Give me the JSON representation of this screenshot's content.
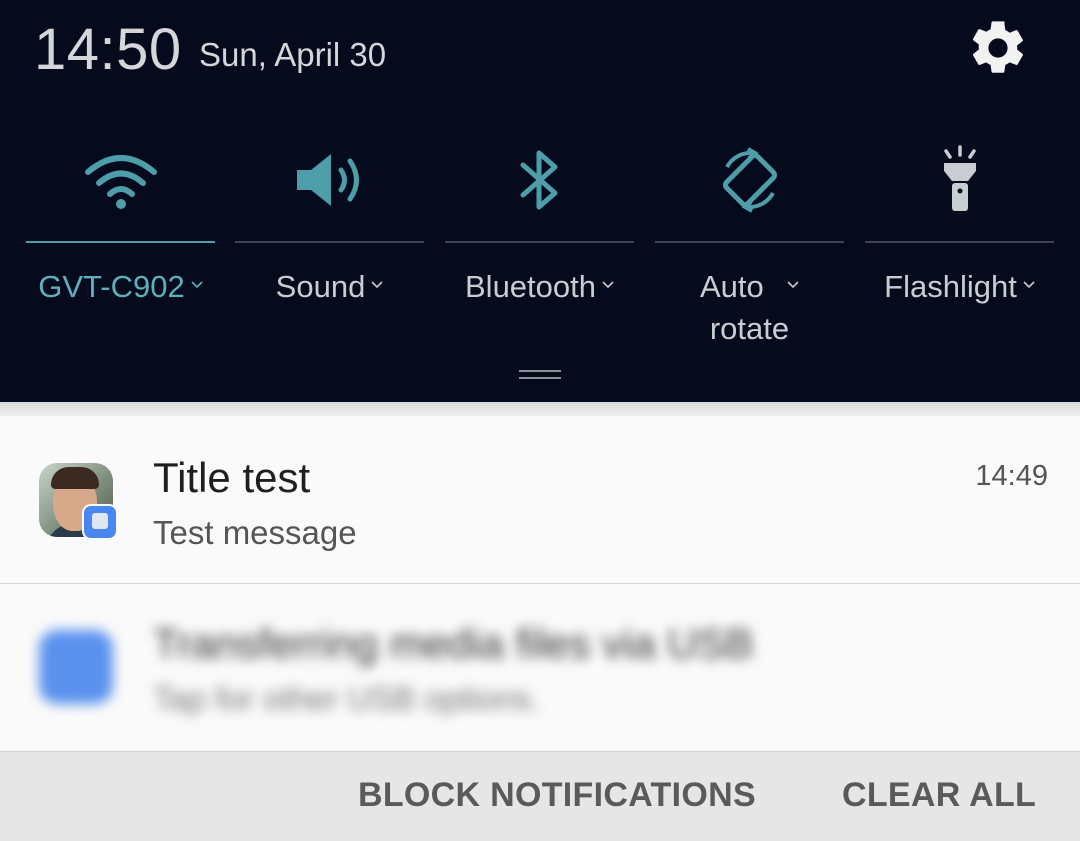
{
  "status": {
    "time": "14:50",
    "date": "Sun, April 30"
  },
  "colors": {
    "shade": "#050b1c",
    "accent": "#5db0bb",
    "text": "#c9ccd1",
    "card": "#fafafa"
  },
  "quick_settings": [
    {
      "label": "GVT-C902",
      "icon": "wifi-icon",
      "active": true
    },
    {
      "label": "Sound",
      "icon": "speaker-icon",
      "active": false
    },
    {
      "label": "Bluetooth",
      "icon": "bluetooth-icon",
      "active": false
    },
    {
      "label_line1": "Auto",
      "label_line2": "rotate",
      "icon": "rotate-icon",
      "active": false
    },
    {
      "label": "Flashlight",
      "icon": "flashlight-icon",
      "active": false
    }
  ],
  "notifications": [
    {
      "title": "Title test",
      "message": "Test message",
      "time": "14:49"
    },
    {
      "title": "Transferring media files via USB",
      "message": "Tap for other USB options."
    }
  ],
  "actions": {
    "block": "BLOCK NOTIFICATIONS",
    "clear": "CLEAR ALL"
  }
}
